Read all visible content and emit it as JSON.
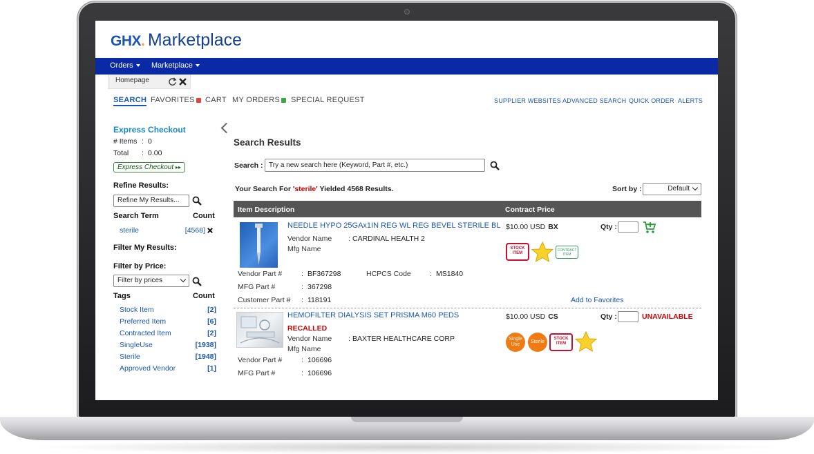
{
  "app": {
    "logo_brand": "GHX",
    "logo_dot": ".",
    "logo_product": "Marketplace"
  },
  "nav": {
    "orders": "Orders",
    "marketplace": "Marketplace"
  },
  "tab": {
    "label": "Homepage"
  },
  "topnav": {
    "search": "SEARCH",
    "favorites": "FAVORITES",
    "cart": "CART",
    "my_orders": "MY ORDERS",
    "special_request": "SPECIAL REQUEST"
  },
  "rightnav": {
    "supplier_websites": "SUPPLIER WEBSITES",
    "advanced_search": "ADVANCED SEARCH",
    "quick_order": "QUICK ORDER",
    "alerts": "ALERTS"
  },
  "sidebar": {
    "express_checkout_title": "Express Checkout",
    "items_label": "# Items",
    "items_value": "0",
    "total_label": "Total",
    "total_value": "0.00",
    "express_checkout_button": "Express Checkout",
    "express_checkout_arrow": "▸▸",
    "refine_title": "Refine Results:",
    "refine_placeholder": "Refine My Results...",
    "search_term_header": "Search Term",
    "count_header": "Count",
    "search_term": "sterile",
    "search_term_count": "[4568]",
    "filter_results_title": "Filter My Results:",
    "filter_price_title": "Filter by Price:",
    "filter_price_value": "Filter by prices",
    "tags_header": "Tags",
    "tags_count_header": "Count",
    "tags": [
      {
        "label": "Stock Item",
        "count": "[2]"
      },
      {
        "label": "Preferred Item",
        "count": "[6]"
      },
      {
        "label": "Contracted Item",
        "count": "[2]"
      },
      {
        "label": "SingleUse",
        "count": "[1938]"
      },
      {
        "label": "Sterile",
        "count": "[1948]"
      },
      {
        "label": "Approved Vendor",
        "count": "[1]"
      }
    ]
  },
  "main": {
    "title": "Search Results",
    "search_label": "Search",
    "search_placeholder": "Try a new search here (Keyword, Part #, etc.)",
    "results_prefix": "Your Search For '",
    "results_term": "sterile",
    "results_suffix": "' Yielded 4568 Results.",
    "sort_label": "Sort by",
    "sort_value": "Default",
    "col_item": "Item Description",
    "col_price": "Contract Price"
  },
  "products": [
    {
      "name": "NEEDLE HYPO 25GAx1IN REG WL REG BEVEL STERILE BL",
      "vendor_label": "Vendor Name",
      "vendor": "CARDINAL HEALTH 2",
      "mfg_label": "Mfg Name",
      "price": "$10.00 USD",
      "unit": "BX",
      "qty_label": "Qty",
      "vendor_part_label": "Vendor Part #",
      "vendor_part": "BF367298",
      "hcpcs_label": "HCPCS Code",
      "hcpcs": "MS1840",
      "mfg_part_label": "MFG Part #",
      "mfg_part": "367298",
      "customer_part_label": "Customer Part #",
      "customer_part": "118191",
      "add_favorites": "Add to Favorites",
      "tag_stock_1": "STOCK",
      "tag_stock_2": "ITEM",
      "tag_contract_1": "CONTRACT",
      "tag_contract_2": "ITEM"
    },
    {
      "name": "HEMOFILTER DIALYSIS SET PRISMA M60 PEDS",
      "recalled": "RECALLED",
      "vendor_label": "Vendor Name",
      "vendor": "BAXTER HEALTHCARE CORP",
      "mfg_label": "Mfg Name",
      "price": "$10.00 USD",
      "unit": "CS",
      "qty_label": "Qty",
      "status": "UNAVAILABLE",
      "vendor_part_label": "Vendor Part #",
      "vendor_part": "106696",
      "mfg_part_label": "MFG Part #",
      "mfg_part": "106696",
      "tag_single_1": "Single",
      "tag_single_2": "Use",
      "tag_sterile": "Sterile",
      "tag_stock_1": "STOCK",
      "tag_stock_2": "ITEM"
    }
  ],
  "colors": {
    "brand_blue": "#1a56b0",
    "navbar": "#0a2aa5",
    "accent_orange": "#f07b13",
    "recall_red": "#cc0000"
  }
}
